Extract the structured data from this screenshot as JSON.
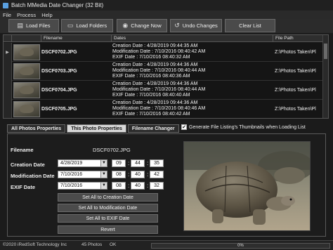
{
  "window": {
    "title": "Batch MMedia Date Changer (32 Bit)"
  },
  "menu": [
    "File",
    "Process",
    "Help"
  ],
  "toolbar": {
    "load_files": "Load Files",
    "load_folders": "Load Folders",
    "change_now": "Change Now",
    "undo_changes": "Undo Changes",
    "clear_list": "Clear List"
  },
  "grid": {
    "headers": [
      "Filename",
      "Dates",
      "File Path"
    ],
    "rows": [
      {
        "filename": "DSCF0702.JPG",
        "creation": "Creation Date : 4/28/2019 09:44:35 AM",
        "modification": "Modification Date : 7/10/2016 08:40:42 AM",
        "exif": "EXIF Date : 7/10/2016 08:40:32 AM",
        "path": "Z:\\Photos Taken\\Pl"
      },
      {
        "filename": "DSCF0703.JPG",
        "creation": "Creation Date : 4/28/2019 09:44:36 AM",
        "modification": "Modification Date : 7/10/2016 08:40:44 AM",
        "exif": "EXIF Date : 7/10/2016 08:40:36 AM",
        "path": "Z:\\Photos Taken\\Pl"
      },
      {
        "filename": "DSCF0704.JPG",
        "creation": "Creation Date : 4/28/2019 09:44:36 AM",
        "modification": "Modification Date : 7/10/2016 08:40:44 AM",
        "exif": "EXIF Date : 7/10/2016 08:40:40 AM",
        "path": "Z:\\Photos Taken\\Pl"
      },
      {
        "filename": "DSCF0705.JPG",
        "creation": "Creation Date : 4/28/2019 09:44:36 AM",
        "modification": "Modification Date : 7/10/2016 08:40:46 AM",
        "exif": "EXIF Date : 7/10/2016 08:40:42 AM",
        "path": "Z:\\Photos Taken\\Pl"
      }
    ]
  },
  "tabs": [
    "All Photos Properties",
    "This Photo Properties",
    "Filename Changer"
  ],
  "active_tab": 1,
  "thumbnail_option": {
    "label": "Generate File Listing's Thumbnails when Loading List",
    "checked": "✔"
  },
  "properties": {
    "filename_label": "Filename",
    "filename_value": "DSCF0702.JPG",
    "creation_label": "Creation Date",
    "creation_date": "4/28/2019",
    "creation_h": "09",
    "creation_m": "44",
    "creation_s": "35",
    "modification_label": "Modification Date",
    "modification_date": "7/10/2016",
    "modification_h": "08",
    "modification_m": "40",
    "modification_s": "42",
    "exif_label": "EXIF Date",
    "exif_date": "7/10/2016",
    "exif_h": "08",
    "exif_m": "40",
    "exif_s": "32",
    "btn_all_creation": "Set All to Creation Date",
    "btn_all_modification": "Set All to Modification Date",
    "btn_all_exif": "Set All to EXIF Date",
    "btn_revert": "Revert"
  },
  "status": {
    "copyright": "©2020 iRedSoft Technology Inc",
    "photo_count": "45 Photos",
    "state": "OK",
    "progress_text": "0%",
    "progress": 0
  },
  "colors": {
    "accent": "#4a90d9",
    "background": "#1b1b1b"
  }
}
